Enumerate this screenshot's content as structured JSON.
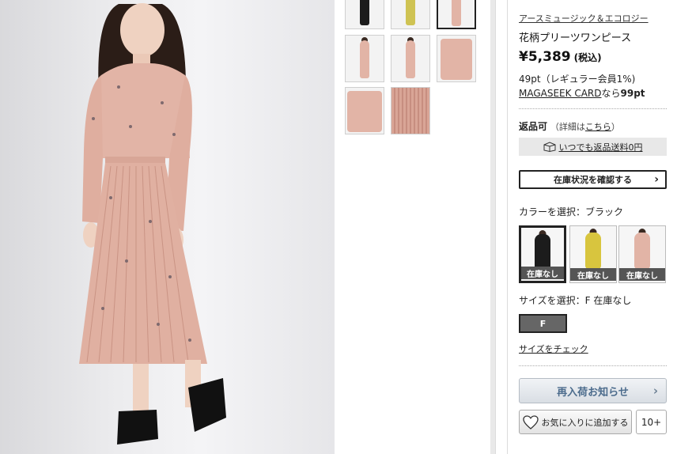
{
  "product": {
    "brand": "アースミュージック＆エコロジー",
    "name": "花柄プリーツワンピース",
    "price": "¥5,389",
    "tax_note": "(税込)",
    "points": "49pt（レギュラー会員1%)",
    "card_link": "MAGASEEK CARD",
    "card_suffix": "なら",
    "card_points": "99pt"
  },
  "returns": {
    "label": "返品可",
    "detail_prefix": "（詳細は",
    "detail_link": "こちら",
    "detail_suffix": "）",
    "free_shipping": "いつでも返品送料0円"
  },
  "stock_button": "在庫状況を確認する",
  "color": {
    "label": "カラーを選択：ブラック",
    "swatches": [
      {
        "badge": "在庫なし",
        "color": "#1c1c1c"
      },
      {
        "badge": "在庫なし",
        "color": "#d8c53e"
      },
      {
        "badge": "在庫なし",
        "color": "#e2b4a6"
      }
    ]
  },
  "size": {
    "label": "サイズを選択：F 在庫なし",
    "option": "F",
    "check_link": "サイズをチェック"
  },
  "actions": {
    "restock": "再入荷お知らせ",
    "favorite": "お気に入りに追加する",
    "favorite_count": "10+"
  },
  "thumbnails": [
    {
      "color": "#1c1c1c",
      "active": false
    },
    {
      "color": "#cfc353",
      "active": false
    },
    {
      "color": "#e2b4a6",
      "active": true
    },
    {
      "color": "#e2b4a6",
      "active": false
    },
    {
      "color": "#e2b4a6",
      "active": false
    },
    {
      "color": "#e2b4a6",
      "active": false
    },
    {
      "color": "#e2b4a6",
      "active": false
    },
    {
      "color": "#d9a596",
      "active": false
    }
  ],
  "colors": {
    "dress": "#e2b4a6",
    "accent_link": "#4b6b8c"
  }
}
